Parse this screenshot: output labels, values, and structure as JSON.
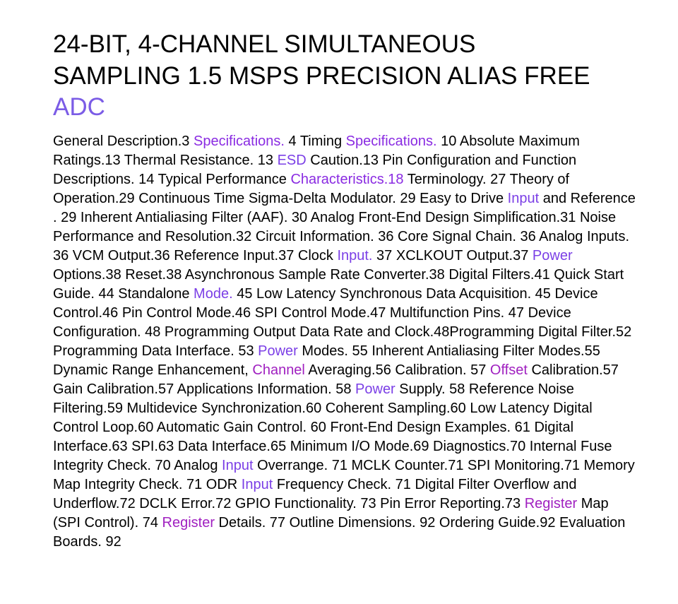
{
  "title": {
    "line1": "24-BIT, 4-CHANNEL SIMULTANEOUS",
    "line2": "SAMPLING 1.5 MSPS PRECISION ALIAS FREE",
    "line3": "ADC"
  },
  "colors": {
    "text": "#000000",
    "link_accent": "#7b5ce6",
    "link_violet": "#8a2be2",
    "link_purple": "#a020c0"
  },
  "toc": [
    {
      "text": "General Description.3 "
    },
    {
      "text": "Specifications.",
      "link": true,
      "tone": "v"
    },
    {
      "text": " 4 Timing "
    },
    {
      "text": "Specifications.",
      "link": true,
      "tone": "v"
    },
    {
      "text": " 10 Absolute Maximum Ratings.13 Thermal Resistance. 13 "
    },
    {
      "text": "ESD",
      "link": true
    },
    {
      "text": " Caution.13 Pin Configuration and Function Descriptions. 14 Typical Performance "
    },
    {
      "text": "Characteristics.18",
      "link": true,
      "tone": "v"
    },
    {
      "text": " Terminology. 27 Theory of Operation.29 Continuous Time Sigma-Delta Modulator. 29 Easy to Drive "
    },
    {
      "text": "Input",
      "link": true
    },
    {
      "text": " and Reference . 29 Inherent Antialiasing Filter (AAF). 30 Analog Front-End Design Simplification.31 Noise Performance and Resolution.32 Circuit Information. 36 Core Signal Chain. 36 Analog Inputs. 36 VCM Output.36 Reference Input.37 Clock "
    },
    {
      "text": "Input.",
      "link": true
    },
    {
      "text": " 37 XCLKOUT Output.37 "
    },
    {
      "text": "Power",
      "link": true
    },
    {
      "text": " Options.38 Reset.38 Asynchronous Sample Rate Converter.38 Digital Filters.41 Quick Start Guide. 44 Standalone "
    },
    {
      "text": "Mode.",
      "link": true
    },
    {
      "text": " 45 Low Latency Synchronous Data Acquisition. 45 Device Control.46 Pin Control Mode.46 SPI Control Mode.47 Multifunction Pins. 47 Device Configuration. 48 Programming Output Data Rate and Clock.48Programming Digital Filter.52 Programming Data Interface. 53 "
    },
    {
      "text": "Power",
      "link": true
    },
    {
      "text": " Modes. 55 Inherent Antialiasing Filter Modes.55 Dynamic Range Enhancement, "
    },
    {
      "text": "Channel",
      "link": true,
      "tone": "p"
    },
    {
      "text": " Averaging.56 Calibration. 57 "
    },
    {
      "text": "Offset",
      "link": true,
      "tone": "p"
    },
    {
      "text": " Calibration.57 Gain Calibration.57 Applications Information. 58 "
    },
    {
      "text": "Power",
      "link": true
    },
    {
      "text": " Supply. 58 Reference Noise Filtering.59 Multidevice Synchronization.60 Coherent Sampling.60 Low Latency Digital Control Loop.60 Automatic Gain Control. 60 Front-End Design Examples. 61 Digital Interface.63 SPI.63 Data Interface.65 Minimum I/O Mode.69 Diagnostics.70 Internal Fuse Integrity Check. 70 Analog "
    },
    {
      "text": "Input",
      "link": true
    },
    {
      "text": " Overrange. 71 MCLK Counter.71 SPI Monitoring.71 Memory Map Integrity Check. 71 ODR "
    },
    {
      "text": "Input",
      "link": true
    },
    {
      "text": " Frequency Check. 71 Digital Filter Overflow and Underflow.72 DCLK Error.72 GPIO Functionality. 73 Pin Error Reporting.73 "
    },
    {
      "text": "Register",
      "link": true,
      "tone": "p"
    },
    {
      "text": " Map (SPI Control). 74 "
    },
    {
      "text": "Register",
      "link": true,
      "tone": "p"
    },
    {
      "text": " Details. 77 Outline Dimensions. 92 Ordering Guide.92 Evaluation Boards. 92"
    }
  ]
}
